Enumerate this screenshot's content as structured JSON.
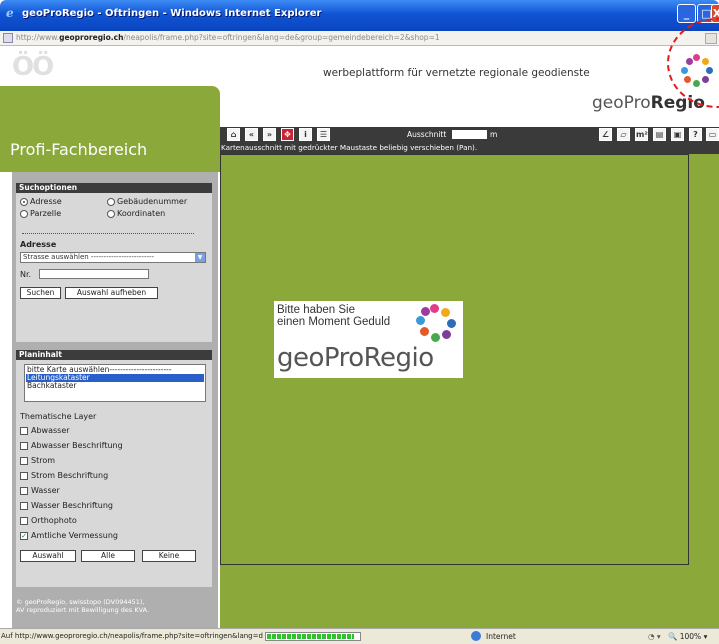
{
  "window": {
    "title": "geoProRegio - Oftringen - Windows Internet Explorer",
    "url_prefix": "http://www.",
    "url_domain": "geoproregio.ch",
    "url_path": "/neapolis/frame.php?site=oftringen&lang=de&group=gemeindebereich=2&shop=1"
  },
  "header": {
    "tagline": "werbeplattform für vernetzte regionale geodienste",
    "brand_light": "geoPro",
    "brand_bold": "Regio"
  },
  "left": {
    "title": "Profi-Fachbereich",
    "search": {
      "heading": "Suchoptionen",
      "options": [
        "Adresse",
        "Gebäudenummer",
        "Parzelle",
        "Koordinaten"
      ],
      "selected": "Adresse"
    },
    "address": {
      "heading": "Adresse",
      "street_select": "Strasse auswählen -------------------------",
      "nr_label": "Nr.",
      "search_button": "Suchen",
      "clear_button": "Auswahl aufheben"
    },
    "plan": {
      "heading": "Planinhalt",
      "maps": [
        "bitte Karte auswählen-----------------------",
        "Leitungskataster",
        "Bachkataster"
      ],
      "selected_map": "Leitungskataster",
      "layers_heading": "Thematische Layer",
      "layers": [
        {
          "label": "Abwasser",
          "checked": false
        },
        {
          "label": "Abwasser Beschriftung",
          "checked": false
        },
        {
          "label": "Strom",
          "checked": false
        },
        {
          "label": "Strom Beschriftung",
          "checked": false
        },
        {
          "label": "Wasser",
          "checked": false
        },
        {
          "label": "Wasser Beschriftung",
          "checked": false
        },
        {
          "label": "Orthophoto",
          "checked": false
        },
        {
          "label": "Amtliche Vermessung",
          "checked": true
        }
      ],
      "btn_selection": "Auswahl",
      "btn_all": "Alle",
      "btn_none": "Keine"
    },
    "copyright_1": "© geoProRegio, swisstopo (DV094451),",
    "copyright_2": "AV reproduziert mit Bewilligung des KVA."
  },
  "toolbar": {
    "scale_label": "Ausschnitt",
    "scale_value": "",
    "scale_unit": "m",
    "hint": "Kartenausschnitt mit gedrückter Maustaste beliebig verschieben (Pan)."
  },
  "map": {
    "loading_msg": "Bitte haben Sie\neinen Moment Geduld",
    "loading_brand": "geoProRegio"
  },
  "status": {
    "text": "Auf http://www.geoproregio.ch/neapolis/frame.php?site=oftringen&lang=de&",
    "zone": "Internet",
    "zoom": "100%",
    "progress": 0.95
  },
  "colors": {
    "panel_green": "#8ba83a",
    "panel_grey": "#afafaf",
    "header_dark": "#3c3c3c",
    "dots": [
      "#e03c8a",
      "#f2a81d",
      "#2f6db5",
      "#7c3f98",
      "#4aa84c",
      "#e35a2a",
      "#3a9ad9",
      "#9c3c9c"
    ]
  }
}
